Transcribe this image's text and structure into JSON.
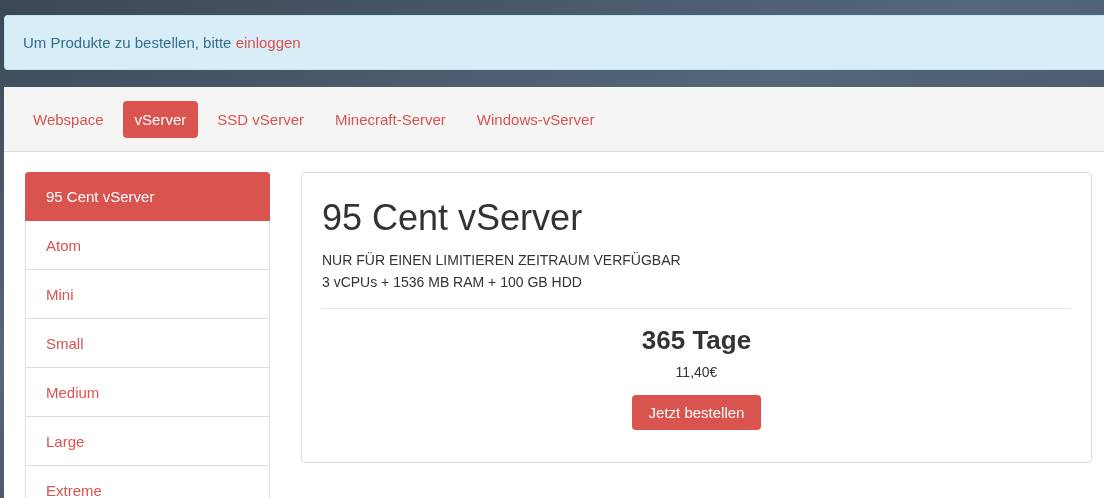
{
  "alert": {
    "text": "Um Produkte zu bestellen, bitte",
    "link": "einloggen"
  },
  "tabs": [
    {
      "label": "Webspace",
      "selected": false
    },
    {
      "label": "vServer",
      "selected": true
    },
    {
      "label": "SSD vServer",
      "selected": false
    },
    {
      "label": "Minecraft-Server",
      "selected": false
    },
    {
      "label": "Windows-vServer",
      "selected": false
    }
  ],
  "sidebar": {
    "items": [
      {
        "label": "95 Cent vServer",
        "selected": true
      },
      {
        "label": "Atom",
        "selected": false
      },
      {
        "label": "Mini",
        "selected": false
      },
      {
        "label": "Small",
        "selected": false
      },
      {
        "label": "Medium",
        "selected": false
      },
      {
        "label": "Large",
        "selected": false
      },
      {
        "label": "Extreme",
        "selected": false
      }
    ]
  },
  "product": {
    "title": "95 Cent vServer",
    "notice": "NUR FÜR EINEN LIMITIEREN ZEITRAUM VERFÜGBAR",
    "specs": "3 vCPUs + 1536 MB RAM + 100 GB HDD",
    "duration": "365 Tage",
    "price": "11,40€",
    "button": "Jetzt bestellen"
  }
}
